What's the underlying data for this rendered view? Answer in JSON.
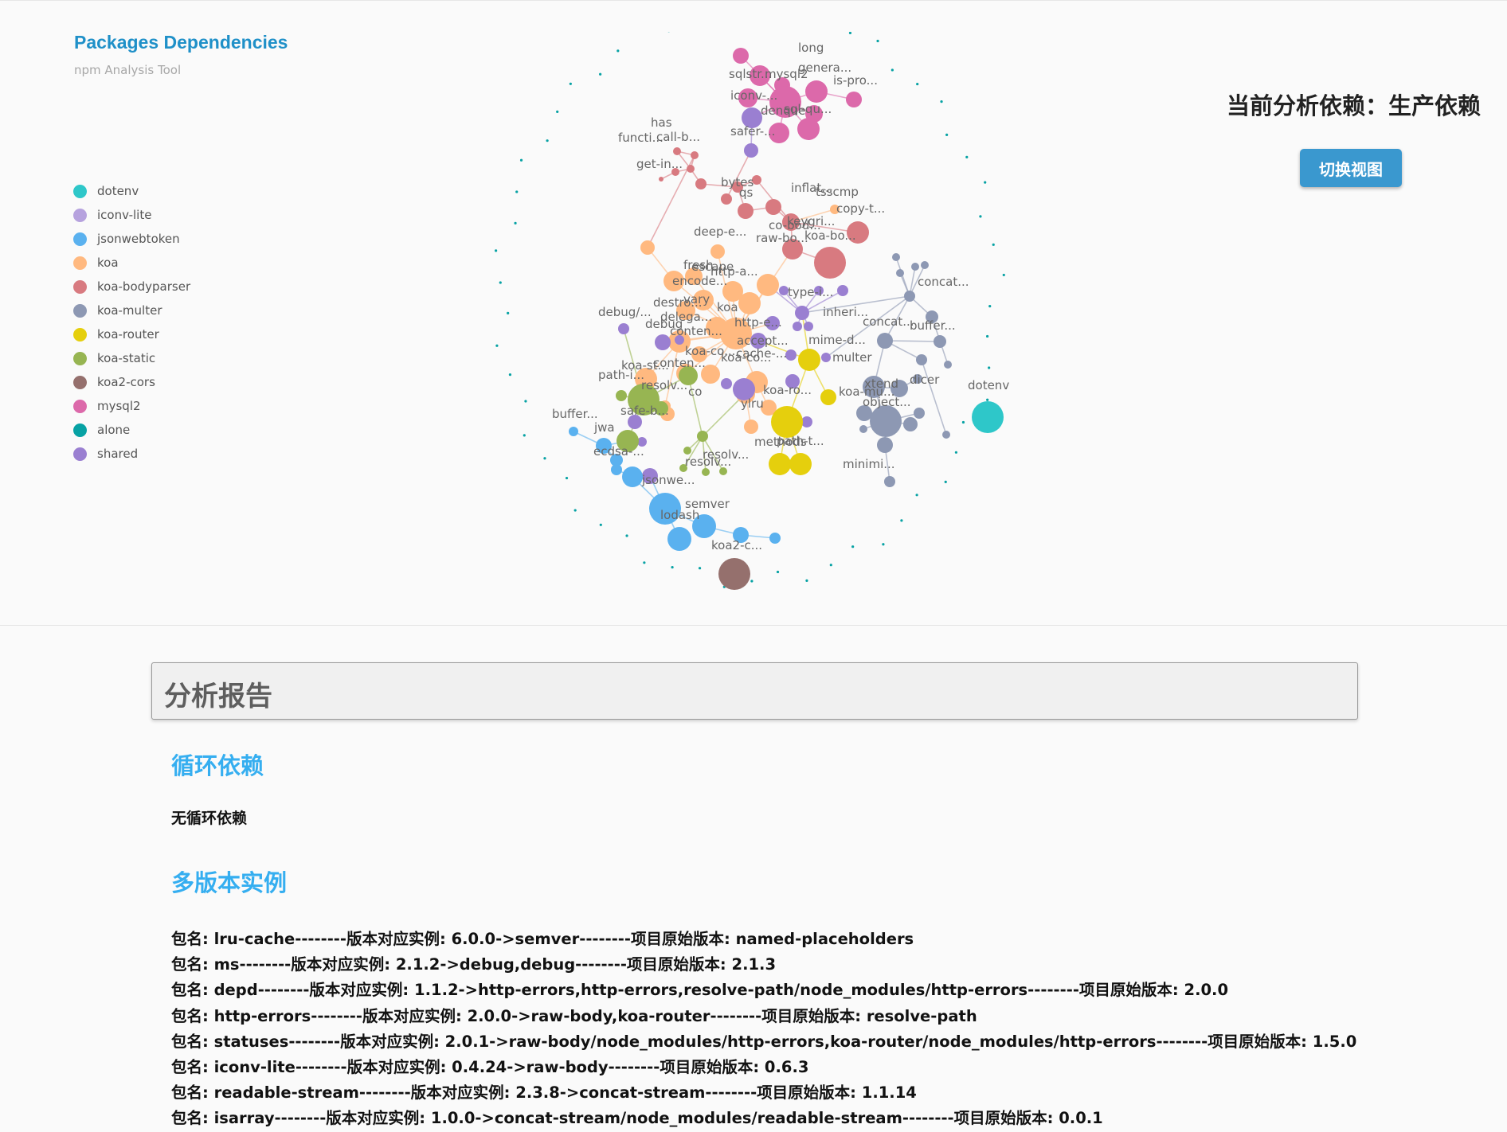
{
  "brand": {
    "title": "Packages Dependencies",
    "subtitle": "npm Analysis Tool"
  },
  "legend": [
    {
      "label": "dotenv",
      "color": "#2ec7c9"
    },
    {
      "label": "iconv-lite",
      "color": "#b6a2de"
    },
    {
      "label": "jsonwebtoken",
      "color": "#5ab1ef"
    },
    {
      "label": "koa",
      "color": "#ffb980"
    },
    {
      "label": "koa-bodyparser",
      "color": "#d87a80"
    },
    {
      "label": "koa-multer",
      "color": "#8d98b3"
    },
    {
      "label": "koa-router",
      "color": "#e5cf0d"
    },
    {
      "label": "koa-static",
      "color": "#97b552"
    },
    {
      "label": "koa2-cors",
      "color": "#95706d"
    },
    {
      "label": "mysql2",
      "color": "#dc69aa"
    },
    {
      "label": "alone",
      "color": "#07a2a4"
    },
    {
      "label": "shared",
      "color": "#9a7fd1"
    }
  ],
  "graph": {
    "node_labels": {
      "long": "long",
      "sqlstr": "sqlstr...",
      "mysql2": "mysql2",
      "genera": "genera...",
      "ispro": "is-pro...",
      "iconv": "iconv-...",
      "denque": "denque",
      "sqlqu": "sql-qu...",
      "safer": "safer-...",
      "has": "has",
      "functi": "functi...",
      "callb": "call-b...",
      "getin": "get-in...",
      "bytes": "bytes",
      "qs": "qs",
      "inflat": "inflat...",
      "tsscmp": "tsscmp",
      "copyt": "copy-t...",
      "deepe": "deep-e...",
      "cobod": "co-bod...",
      "keygri": "keygri...",
      "rawbo": "raw-bo...",
      "koabo": "koa-bo...",
      "fresh": "fresh",
      "escape": "escape",
      "httpa": "http-a...",
      "encode": "encode...",
      "concat1": "concat...",
      "typei": "type-i...",
      "destro": "destro...",
      "vary": "vary",
      "koa": "koa",
      "debugslash": "debug/...",
      "delega": "delega...",
      "debug": "debug",
      "httpe": "http-e...",
      "inheri": "inheri...",
      "concat2": "concat...",
      "buffer1": "buffer...",
      "conten1": "conten...",
      "accept": "accept...",
      "mimed": "mime-d...",
      "koaco1": "koa-co...",
      "koaco2": "koa-co...",
      "cache": "cache-...",
      "multer": "multer",
      "koast": "koa-st...",
      "conten2": "conten...",
      "pathi": "path-i...",
      "resolv1": "resolv...",
      "koaro": "koa-ro...",
      "xtend": "xtend",
      "koamu": "koa-mu...",
      "dicer": "dicer",
      "object": "object...",
      "dotenv": "dotenv",
      "co": "co",
      "safeb": "safe-b...",
      "ylru": "ylru",
      "buffer2": "buffer...",
      "jwa": "jwa",
      "methods": "methods",
      "patht": "path-t...",
      "ecdsa": "ecdsa-...",
      "resolv2": "resolv...",
      "resolv3": "resolv...",
      "minimi": "minimi...",
      "jsonwe": "jsonwe...",
      "semver": "semver",
      "lodash": "lodash",
      "koa2c": "koa2-c..."
    }
  },
  "current_dependency": "当前分析依赖：生产依赖",
  "switch_button": "切换视图",
  "report": {
    "title": "分析报告",
    "cycle_heading": "循环依赖",
    "cycle_text": "无循环依赖",
    "multi_heading": "多版本实例",
    "instances": [
      "包名: lru-cache--------版本对应实例: 6.0.0->semver--------项目原始版本: named-placeholders",
      "包名: ms--------版本对应实例: 2.1.2->debug,debug--------项目原始版本: 2.1.3",
      "包名: depd--------版本对应实例: 1.1.2->http-errors,http-errors,resolve-path/node_modules/http-errors--------项目原始版本: 2.0.0",
      "包名: http-errors--------版本对应实例: 2.0.0->raw-body,koa-router--------项目原始版本: resolve-path",
      "包名: statuses--------版本对应实例: 2.0.1->raw-body/node_modules/http-errors,koa-router/node_modules/http-errors--------项目原始版本: 1.5.0",
      "包名: iconv-lite--------版本对应实例: 0.4.24->raw-body--------项目原始版本: 0.6.3",
      "包名: readable-stream--------版本对应实例: 2.3.8->concat-stream--------项目原始版本: 1.1.14",
      "包名: isarray--------版本对应实例: 1.0.0->concat-stream/node_modules/readable-stream--------项目原始版本: 0.0.1"
    ]
  }
}
